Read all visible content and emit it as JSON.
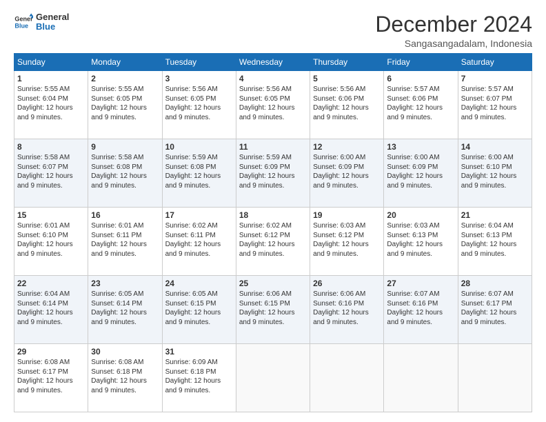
{
  "logo": {
    "line1": "General",
    "line2": "Blue"
  },
  "title": "December 2024",
  "subtitle": "Sangasangadalam, Indonesia",
  "days_of_week": [
    "Sunday",
    "Monday",
    "Tuesday",
    "Wednesday",
    "Thursday",
    "Friday",
    "Saturday"
  ],
  "weeks": [
    [
      {
        "day": "1",
        "sunrise": "5:55 AM",
        "sunset": "6:04 PM",
        "daylight": "12 hours and 9 minutes."
      },
      {
        "day": "2",
        "sunrise": "5:55 AM",
        "sunset": "6:05 PM",
        "daylight": "12 hours and 9 minutes."
      },
      {
        "day": "3",
        "sunrise": "5:56 AM",
        "sunset": "6:05 PM",
        "daylight": "12 hours and 9 minutes."
      },
      {
        "day": "4",
        "sunrise": "5:56 AM",
        "sunset": "6:05 PM",
        "daylight": "12 hours and 9 minutes."
      },
      {
        "day": "5",
        "sunrise": "5:56 AM",
        "sunset": "6:06 PM",
        "daylight": "12 hours and 9 minutes."
      },
      {
        "day": "6",
        "sunrise": "5:57 AM",
        "sunset": "6:06 PM",
        "daylight": "12 hours and 9 minutes."
      },
      {
        "day": "7",
        "sunrise": "5:57 AM",
        "sunset": "6:07 PM",
        "daylight": "12 hours and 9 minutes."
      }
    ],
    [
      {
        "day": "8",
        "sunrise": "5:58 AM",
        "sunset": "6:07 PM",
        "daylight": "12 hours and 9 minutes."
      },
      {
        "day": "9",
        "sunrise": "5:58 AM",
        "sunset": "6:08 PM",
        "daylight": "12 hours and 9 minutes."
      },
      {
        "day": "10",
        "sunrise": "5:59 AM",
        "sunset": "6:08 PM",
        "daylight": "12 hours and 9 minutes."
      },
      {
        "day": "11",
        "sunrise": "5:59 AM",
        "sunset": "6:09 PM",
        "daylight": "12 hours and 9 minutes."
      },
      {
        "day": "12",
        "sunrise": "6:00 AM",
        "sunset": "6:09 PM",
        "daylight": "12 hours and 9 minutes."
      },
      {
        "day": "13",
        "sunrise": "6:00 AM",
        "sunset": "6:09 PM",
        "daylight": "12 hours and 9 minutes."
      },
      {
        "day": "14",
        "sunrise": "6:00 AM",
        "sunset": "6:10 PM",
        "daylight": "12 hours and 9 minutes."
      }
    ],
    [
      {
        "day": "15",
        "sunrise": "6:01 AM",
        "sunset": "6:10 PM",
        "daylight": "12 hours and 9 minutes."
      },
      {
        "day": "16",
        "sunrise": "6:01 AM",
        "sunset": "6:11 PM",
        "daylight": "12 hours and 9 minutes."
      },
      {
        "day": "17",
        "sunrise": "6:02 AM",
        "sunset": "6:11 PM",
        "daylight": "12 hours and 9 minutes."
      },
      {
        "day": "18",
        "sunrise": "6:02 AM",
        "sunset": "6:12 PM",
        "daylight": "12 hours and 9 minutes."
      },
      {
        "day": "19",
        "sunrise": "6:03 AM",
        "sunset": "6:12 PM",
        "daylight": "12 hours and 9 minutes."
      },
      {
        "day": "20",
        "sunrise": "6:03 AM",
        "sunset": "6:13 PM",
        "daylight": "12 hours and 9 minutes."
      },
      {
        "day": "21",
        "sunrise": "6:04 AM",
        "sunset": "6:13 PM",
        "daylight": "12 hours and 9 minutes."
      }
    ],
    [
      {
        "day": "22",
        "sunrise": "6:04 AM",
        "sunset": "6:14 PM",
        "daylight": "12 hours and 9 minutes."
      },
      {
        "day": "23",
        "sunrise": "6:05 AM",
        "sunset": "6:14 PM",
        "daylight": "12 hours and 9 minutes."
      },
      {
        "day": "24",
        "sunrise": "6:05 AM",
        "sunset": "6:15 PM",
        "daylight": "12 hours and 9 minutes."
      },
      {
        "day": "25",
        "sunrise": "6:06 AM",
        "sunset": "6:15 PM",
        "daylight": "12 hours and 9 minutes."
      },
      {
        "day": "26",
        "sunrise": "6:06 AM",
        "sunset": "6:16 PM",
        "daylight": "12 hours and 9 minutes."
      },
      {
        "day": "27",
        "sunrise": "6:07 AM",
        "sunset": "6:16 PM",
        "daylight": "12 hours and 9 minutes."
      },
      {
        "day": "28",
        "sunrise": "6:07 AM",
        "sunset": "6:17 PM",
        "daylight": "12 hours and 9 minutes."
      }
    ],
    [
      {
        "day": "29",
        "sunrise": "6:08 AM",
        "sunset": "6:17 PM",
        "daylight": "12 hours and 9 minutes."
      },
      {
        "day": "30",
        "sunrise": "6:08 AM",
        "sunset": "6:18 PM",
        "daylight": "12 hours and 9 minutes."
      },
      {
        "day": "31",
        "sunrise": "6:09 AM",
        "sunset": "6:18 PM",
        "daylight": "12 hours and 9 minutes."
      },
      null,
      null,
      null,
      null
    ]
  ],
  "labels": {
    "sunrise": "Sunrise: ",
    "sunset": "Sunset: ",
    "daylight": "Daylight: "
  }
}
